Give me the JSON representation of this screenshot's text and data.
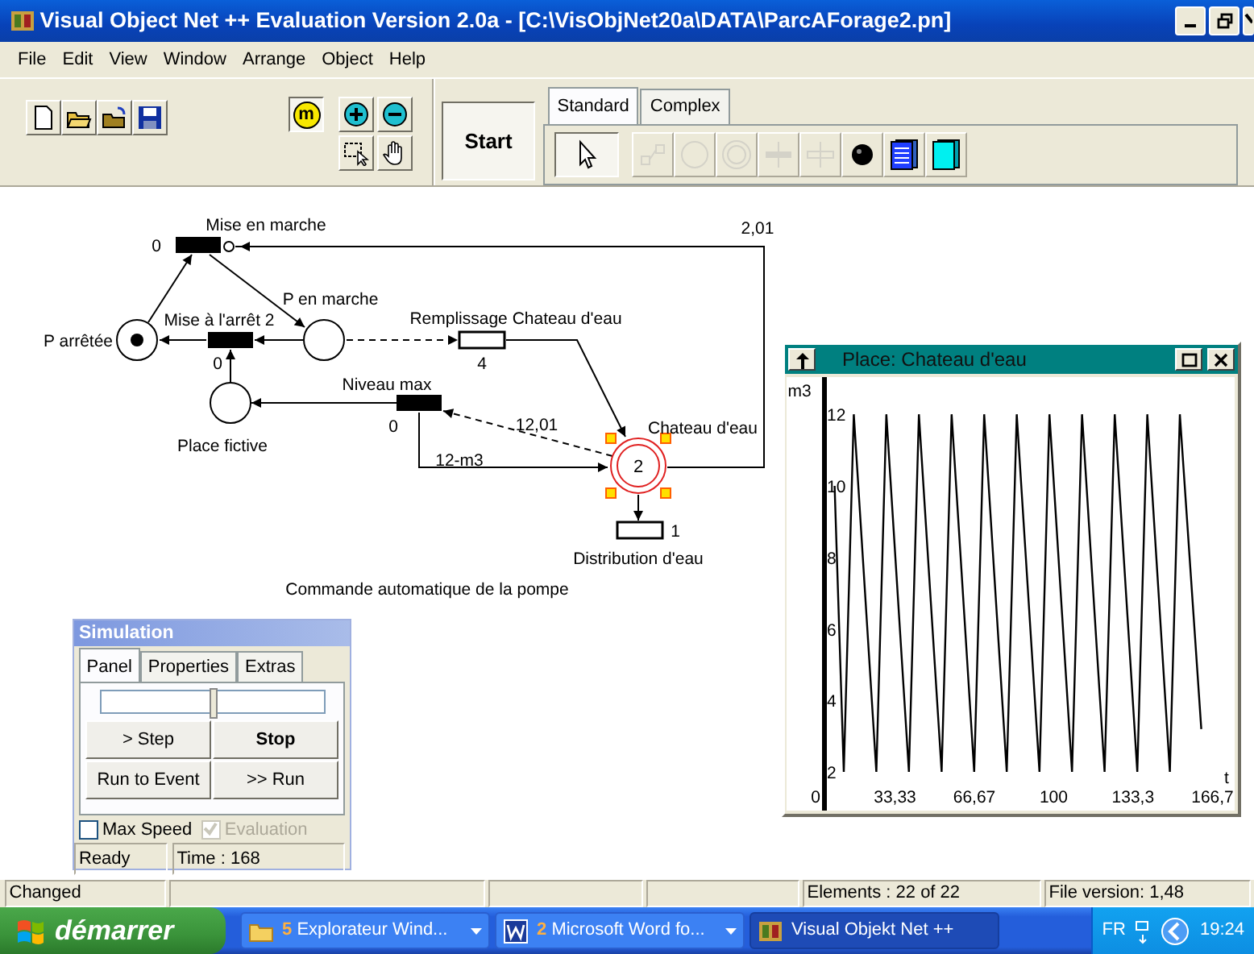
{
  "window": {
    "title": "Visual Object Net ++ Evaluation Version 2.0a - [C:\\VisObjNet20a\\DATA\\ParcAForage2.pn]"
  },
  "menu": [
    "File",
    "Edit",
    "View",
    "Window",
    "Arrange",
    "Object",
    "Help"
  ],
  "toolbar": {
    "mode_button": {
      "label": "m",
      "pressed": true
    },
    "start_button": "Start",
    "palette_tabs": [
      {
        "label": "Standard",
        "selected": true
      },
      {
        "label": "Complex",
        "selected": false
      }
    ],
    "tools": [
      {
        "kind": "pointer",
        "selected": true,
        "disabled": false
      },
      {
        "kind": "connector",
        "selected": false,
        "disabled": true
      },
      {
        "kind": "place",
        "selected": false,
        "disabled": true
      },
      {
        "kind": "double_place",
        "selected": false,
        "disabled": true
      },
      {
        "kind": "transition_plus",
        "selected": false,
        "disabled": true
      },
      {
        "kind": "transition",
        "selected": false,
        "disabled": true
      },
      {
        "kind": "token",
        "selected": false,
        "disabled": false
      },
      {
        "kind": "list",
        "selected": false,
        "disabled": false
      },
      {
        "kind": "box",
        "selected": false,
        "disabled": false
      }
    ]
  },
  "net": {
    "nodes": [
      {
        "kind": "transition",
        "label": "Mise en marche",
        "counter": "0",
        "selected": false
      },
      {
        "kind": "place",
        "label": "P arrêtée",
        "marked": true,
        "selected": false
      },
      {
        "kind": "transition",
        "label": "Mise à l'arrêt 2",
        "counter": "0",
        "selected": false
      },
      {
        "kind": "place",
        "label": "P en marche",
        "marked": false,
        "selected": false
      },
      {
        "kind": "continuous_transition",
        "label": "Remplissage Chateau d'eau",
        "counter": "4",
        "selected": false
      },
      {
        "kind": "transition",
        "label": "Niveau max",
        "counter": "0",
        "selected": false
      },
      {
        "kind": "place",
        "label": "Place fictive",
        "marked": false,
        "selected": false
      },
      {
        "kind": "continuous_place",
        "label": "Chateau d'eau",
        "value": "2",
        "selected": true
      },
      {
        "kind": "continuous_transition",
        "label": "Distribution d'eau",
        "counter": "1",
        "selected": false
      }
    ],
    "arcs": [
      {
        "kind": "normal"
      },
      {
        "kind": "normal"
      },
      {
        "kind": "normal"
      },
      {
        "kind": "normal"
      },
      {
        "kind": "normal"
      },
      {
        "kind": "normal"
      },
      {
        "kind": "test"
      },
      {
        "kind": "normal"
      },
      {
        "kind": "test",
        "label": "12,01"
      },
      {
        "kind": "normal",
        "label": "12-m3"
      },
      {
        "kind": "inhibitor",
        "label": "2,01"
      },
      {
        "kind": "normal"
      }
    ],
    "caption": "Commande automatique de la pompe"
  },
  "plot_window": {
    "title": "Place: Chateau d'eau",
    "chart_data": {
      "type": "line",
      "xlabel": "t",
      "ylabel": "m3",
      "x": [
        8,
        11.8,
        16,
        25.5,
        29.7,
        39.2,
        43.4,
        52.9,
        57.1,
        66.6,
        70.8,
        80.3,
        84.5,
        94,
        98.2,
        107.7,
        111.9,
        121.4,
        125.6,
        135.1,
        139.3,
        148.8,
        153,
        162
      ],
      "series": [
        {
          "color": "#000000",
          "values": [
            10,
            2,
            12,
            2,
            12,
            2,
            12,
            2,
            12,
            2,
            12,
            2,
            12,
            2,
            12,
            2,
            12,
            2,
            12,
            2,
            12,
            2,
            12,
            3.2
          ]
        }
      ],
      "xlim": [
        -12.2,
        176
      ],
      "ylim": [
        0.92,
        13.04
      ],
      "xticks": [
        {
          "value": 0,
          "label": "0"
        },
        {
          "value": 33.33,
          "label": "33,33"
        },
        {
          "value": 66.67,
          "label": "66,67"
        },
        {
          "value": 100,
          "label": "100"
        },
        {
          "value": 133.3,
          "label": "133,3"
        },
        {
          "value": 166.7,
          "label": "166,7"
        }
      ],
      "yticks": [
        2,
        4,
        6,
        8,
        10,
        12
      ]
    }
  },
  "simulation": {
    "title": "Simulation",
    "tabs": [
      {
        "label": "Panel",
        "selected": true
      },
      {
        "label": "Properties",
        "selected": false
      },
      {
        "label": "Extras",
        "selected": false
      }
    ],
    "speed": {
      "level": 0.5
    },
    "buttons": [
      {
        "label": "> Step",
        "default": false
      },
      {
        "label": "Stop",
        "default": true
      },
      {
        "label": "Run to Event",
        "default": false
      },
      {
        "label": ">> Run",
        "default": false
      }
    ],
    "checkboxes": [
      {
        "label": "Max Speed",
        "checked": false,
        "disabled": false
      },
      {
        "label": "Evaluation",
        "checked": true,
        "disabled": true
      }
    ],
    "status": [
      "Ready",
      "Time : 168"
    ]
  },
  "status_bar": {
    "state": "Changed",
    "elements": "Elements : 22 of 22",
    "version": "File version: 1,48"
  },
  "taskbar": {
    "start": "démarrer",
    "tasks": [
      {
        "kind": "folder",
        "number": "5",
        "label": "Explorateur Wind...",
        "grouped": true,
        "selected": false
      },
      {
        "kind": "word",
        "number": "2",
        "label": "Microsoft Word fo...",
        "grouped": true,
        "selected": false
      },
      {
        "kind": "app",
        "label": "Visual Objekt Net ++",
        "grouped": false,
        "selected": true
      }
    ],
    "language": "FR",
    "clock": "19:24"
  }
}
